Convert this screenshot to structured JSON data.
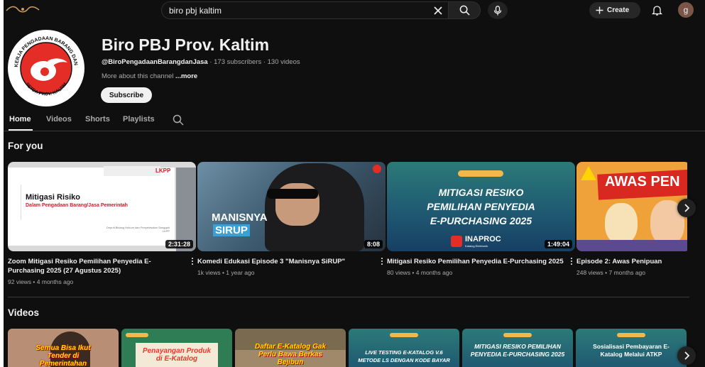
{
  "search": {
    "query": "biro pbj kaltim"
  },
  "header": {
    "create_label": "Create",
    "avatar_letter": "g"
  },
  "channel": {
    "name": "Biro PBJ Prov. Kaltim",
    "handle": "@BiroPengadaanBarangdanJasa",
    "stats": " · 173 subscribers · 130 videos",
    "about": "More about this channel ",
    "more_label": "...more",
    "subscribe_label": "Subscribe",
    "logo_top_text": "UNIT KERJA PENGADAAN BARANG DAN JASA",
    "logo_bottom_text": "SETDA PROV. KALTIM"
  },
  "tabs": [
    {
      "label": "Home",
      "active": true
    },
    {
      "label": "Videos",
      "active": false
    },
    {
      "label": "Shorts",
      "active": false
    },
    {
      "label": "Playlists",
      "active": false
    }
  ],
  "for_you": {
    "title": "For you",
    "videos": [
      {
        "title": "Zoom Mitigasi Resiko Pemilihan Penyedia E-Purchasing 2025 (27 Agustus 2025)",
        "meta": "92 views • 4 months ago",
        "duration": "2:31:28",
        "thumb_heading": "Mitigasi Risiko",
        "thumb_sub": "Dalam Pengadaan Barang/Jasa Pemerintah",
        "thumb_logo": "LKPP",
        "thumb_footer": "Deputi Bidang Hukum dan Penyelesaian Sanggah LKPP"
      },
      {
        "title": "Komedi Edukasi Episode 3 \"Manisnya SiRUP\"",
        "meta": "1k views • 1 year ago",
        "duration": "8:08",
        "thumb_line1": "MANISNYA",
        "thumb_line2": "SIRUP"
      },
      {
        "title": "Mitigasi Resiko Pemilihan Penyedia E-Purchasing 2025",
        "meta": "80 views • 4 months ago",
        "duration": "1:49:04",
        "thumb_lines": [
          "MITIGASI RESIKO",
          "PEMILIHAN PENYEDIA",
          "E-PURCHASING 2025"
        ],
        "thumb_brand": "INAPROC",
        "thumb_brand_sub": "Katalog Elektronik"
      },
      {
        "title": "Episode 2: Awas Penipuan",
        "meta": "248 views • 7 months ago",
        "thumb_banner": "AWAS PEN"
      }
    ]
  },
  "videos_section": {
    "title": "Videos",
    "thumbs": [
      {
        "text": "Semua Bisa Ikut Tender di Pemerintahan"
      },
      {
        "text": "Penayangan Produk di E-Katalog"
      },
      {
        "text": "Daftar E-Katalog Gak Perlu Bawa Berkas Bejibun"
      },
      {
        "text": "LIVE TESTING E-KATALOG V.6 METODE LS DENGAN KODE BAYAR"
      },
      {
        "text": "MITIGASI RESIKO PEMILIHAN PENYEDIA E-PURCHASING 2025"
      },
      {
        "text": "Sosialisasi Pembayaran E-Katalog Melalui ATKP"
      }
    ]
  },
  "colors": {
    "background": "#0f0f0f",
    "text": "#f1f1f1",
    "muted": "#aaaaaa",
    "brand_red": "#e52d27"
  }
}
